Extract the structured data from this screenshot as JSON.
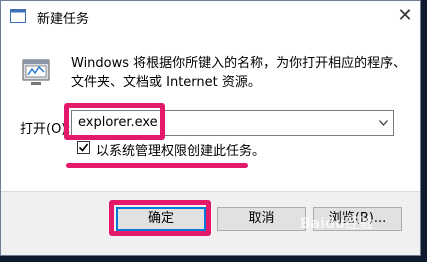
{
  "window": {
    "title": "新建任务",
    "close_glyph": "✕"
  },
  "description": "Windows 将根据你所键入的名称，为你打开相应的程序、文件夹、文档或 Internet 资源。",
  "open_field": {
    "label": "打开(O):",
    "value": "explorer.exe"
  },
  "admin_option": {
    "checked": true,
    "label": "以系统管理权限创建此任务。"
  },
  "buttons": {
    "ok": "确定",
    "cancel": "取消",
    "browse": "浏览(B)..."
  },
  "watermark": "Baidu经验",
  "colors": {
    "highlight": "#e3196b",
    "ok_focus": "#0078d7",
    "button_bar": "#f0f0f0"
  },
  "icons": {
    "app": "window-icon",
    "run": "run-program-icon",
    "dropdown": "chevron-down-icon",
    "close": "close-icon"
  }
}
